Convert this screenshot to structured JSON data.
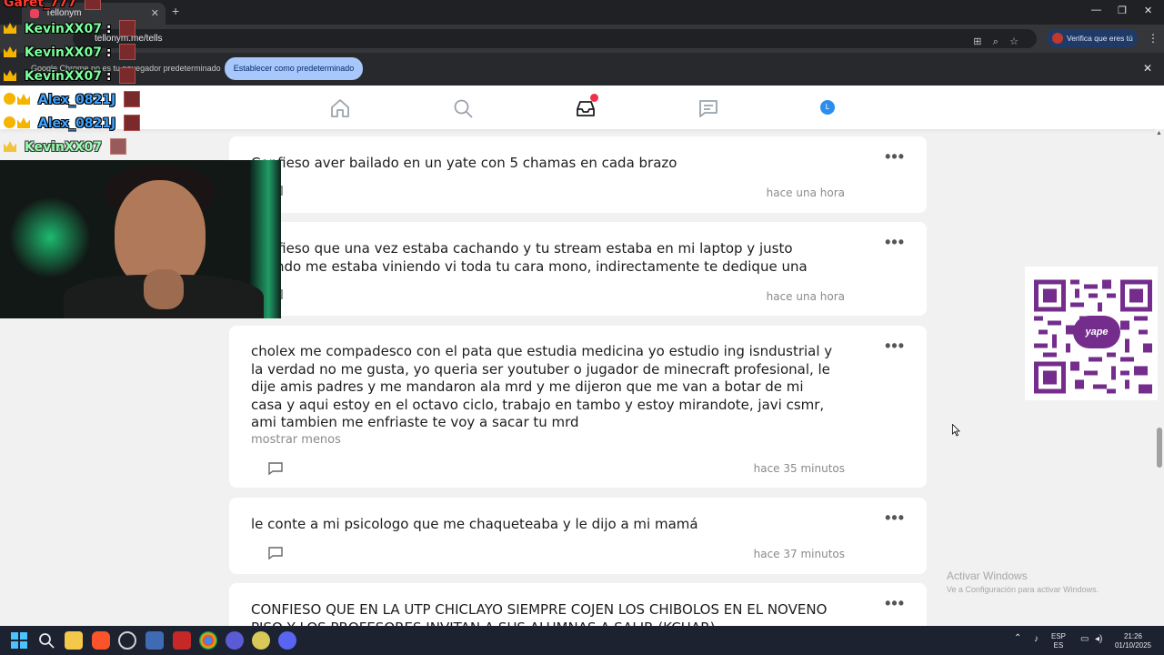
{
  "browser": {
    "tab_title": "Tellonym",
    "url": "tellonym.me/tells",
    "verify_label": "Verifica que eres tú",
    "infobar_text": "Google Chrome no es tu navegador predeterminado",
    "default_button_label": "Establecer como predeterminado"
  },
  "stream_chat": [
    {
      "user": "Garet_777",
      "color": "#ff3b30",
      "badges": 0
    },
    {
      "user": "KevinXX07",
      "color": "#79ff9b",
      "badges": 1
    },
    {
      "user": "KevinXX07",
      "color": "#79ff9b",
      "badges": 1
    },
    {
      "user": "KevinXX07",
      "color": "#79ff9b",
      "badges": 1
    },
    {
      "user": "Alex_0821J",
      "color": "#3da3ff",
      "badges": 2
    },
    {
      "user": "Alex_0821J",
      "color": "#3da3ff",
      "badges": 2
    },
    {
      "user": "KevinXX07",
      "color": "#79ff9b",
      "badges": 1
    }
  ],
  "nav": {
    "icons": [
      "home-icon",
      "search-icon",
      "inbox-icon",
      "messages-icon",
      "profile-icon"
    ],
    "avatar_letter": "L",
    "accent": "#2d8cf0",
    "notif_color": "#f0314b"
  },
  "tells": [
    {
      "text": "Confieso aver bailado en un yate con 5 chamas en cada brazo",
      "time": "hace una hora"
    },
    {
      "text": "Confieso que una vez estaba cachando y tu stream estaba en mi laptop y justo cuando me estaba viniendo vi toda tu cara mono, indirectamente te dedique una",
      "time": "hace una hora"
    },
    {
      "text": "cholex me compadesco con el pata que estudia medicina yo estudio ing isndustrial y la verdad no me gusta, yo queria ser youtuber o jugador de minecraft profesional, le dije amis padres y me mandaron ala mrd y me dijeron que me van a botar de mi casa y aqui estoy en el octavo ciclo, trabajo en tambo y estoy mirandote, javi csmr, ami tambien me enfriaste te voy a sacar tu mrd",
      "toggle": "mostrar menos",
      "time": "hace 35 minutos"
    },
    {
      "text": "le conte a mi psicologo que me chaqueteaba y le dijo a mi mamá",
      "time": "hace 37 minutos"
    },
    {
      "text": "CONFIESO QUE EN LA UTP CHICLAYO SIEMPRE COJEN LOS CHIBOLOS EN EL NOVENO PISO Y LOS PROFESORES INVITAN A SUS ALUMNAS A SALIR (KCHAR)",
      "time": ""
    }
  ],
  "qr": {
    "logo_text": "yape",
    "logo_color": "#742d8c"
  },
  "watermark": {
    "title": "Activar Windows",
    "subtitle": "Ve a Configuración para activar Windows."
  },
  "taskbar": {
    "lang": "ESP",
    "lang2": "ES",
    "time": "21:26",
    "date": "01/10/2025"
  }
}
